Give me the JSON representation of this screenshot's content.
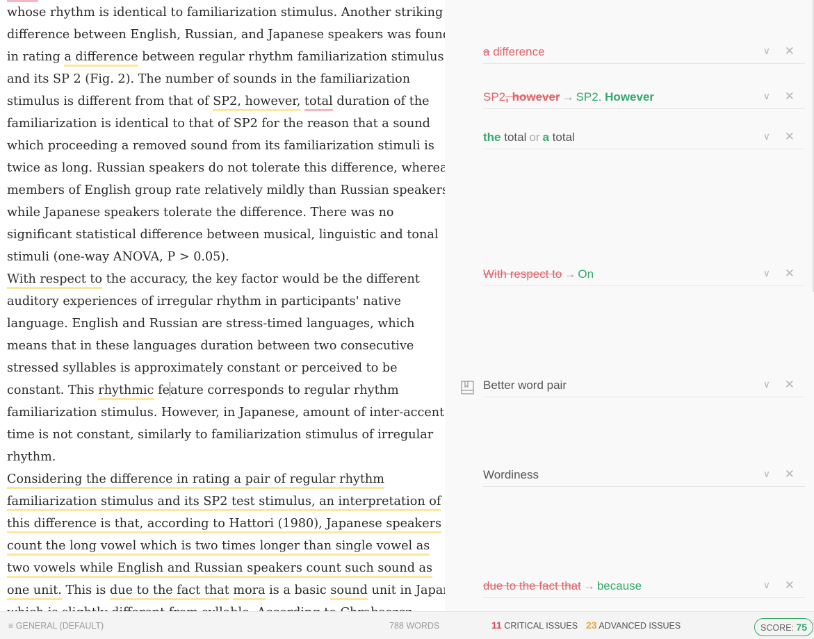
{
  "document": {
    "lines": [
      [
        {
          "t": "whose rhythm is identical to familiarization stimulus. Another striking"
        }
      ],
      [
        {
          "t": "difference between English, Russian, and Japanese speakers was found"
        }
      ],
      [
        {
          "t": "in rating "
        },
        {
          "t": "a difference",
          "u": "y"
        },
        {
          "t": " between regular rhythm familiarization stimulus"
        }
      ],
      [
        {
          "t": "and its SP 2 (Fig. 2). The number of sounds in the familiarization"
        }
      ],
      [
        {
          "t": "stimulus is different from that of "
        },
        {
          "t": "SP2, however,",
          "u": "y"
        },
        {
          "t": " "
        },
        {
          "t": "total",
          "u": "r"
        },
        {
          "t": " duration of the"
        }
      ],
      [
        {
          "t": "familiarization is identical to that of SP2 for the reason that a sound"
        }
      ],
      [
        {
          "t": "which proceeding a removed sound from its familiarization stimuli is"
        }
      ],
      [
        {
          "t": "twice as long. Russian speakers do not tolerate this difference, whereas"
        }
      ],
      [
        {
          "t": "members of English group rate relatively mildly than Russian speakers"
        }
      ],
      [
        {
          "t": "while Japanese speakers tolerate the difference. There was no"
        }
      ],
      [
        {
          "t": "significant statistical difference between musical, linguistic and tonal"
        }
      ],
      [
        {
          "t": "stimuli (one-way ANOVA, P > 0.05)."
        }
      ],
      [
        {
          "t": "With respect to",
          "u": "y"
        },
        {
          "t": " the accuracy, the key factor would be the different"
        }
      ],
      [
        {
          "t": "auditory experiences of irregular rhythm in participants' native"
        }
      ],
      [
        {
          "t": "language. English and Russian are stress-timed languages, which"
        }
      ],
      [
        {
          "t": "means that in these languages duration between two consecutive"
        }
      ],
      [
        {
          "t": "stressed syllables is approximately constant or perceived to be"
        }
      ],
      [
        {
          "t": "constant. This "
        },
        {
          "t": "rhythmic",
          "u": "y"
        },
        {
          "t": " fe"
        },
        {
          "caret": true
        },
        {
          "t": "ature corresponds to regular rhythm"
        }
      ],
      [
        {
          "t": "familiarization stimulus. However, in Japanese, amount of inter-accent"
        }
      ],
      [
        {
          "t": "time is not constant, similarly to familiarization stimulus of irregular"
        }
      ],
      [
        {
          "t": "rhythm."
        }
      ],
      [
        {
          "t": "Considering the difference in rating a pair of regular rhythm ",
          "u": "y"
        }
      ],
      [
        {
          "t": "familiarization stimulus and its SP2 test stimulus, an interpretation of",
          "u": "y"
        }
      ],
      [
        {
          "t": "this difference is that, according to Hattori (1980), Japanese speakers",
          "u": "y"
        }
      ],
      [
        {
          "t": "count the long vowel which is two times longer than single vowel as",
          "u": "y"
        }
      ],
      [
        {
          "t": "two vowels while English and Russian speakers count such sound as",
          "u": "y"
        }
      ],
      [
        {
          "t": "one unit.",
          "u": "y"
        },
        {
          "t": " This is "
        },
        {
          "t": "due to the fact that",
          "u": "y"
        },
        {
          "t": " "
        },
        {
          "t": "mora",
          "u": "y"
        },
        {
          "t": " is a basic "
        },
        {
          "t": "sound",
          "u": "y"
        },
        {
          "t": " unit in Japan"
        }
      ],
      [
        {
          "t": "which is slightly different from syllable. According to Chrabaszcz"
        }
      ]
    ]
  },
  "suggestions": [
    {
      "segs": [
        {
          "t": "a",
          "c": "del"
        },
        {
          "t": " difference",
          "c": "red"
        }
      ]
    },
    {
      "segs": [
        {
          "t": "SP2",
          "c": "red"
        },
        {
          "t": ", however",
          "c": "del bold"
        },
        {
          "t": "→",
          "c": "arrow"
        },
        {
          "t": "SP2. ",
          "c": "green"
        },
        {
          "t": "However",
          "c": "green bold"
        }
      ]
    },
    {
      "segs": [
        {
          "t": "the",
          "c": "green bold"
        },
        {
          "t": " total",
          "c": "gray"
        },
        {
          "t": "or",
          "c": "or"
        },
        {
          "t": "a",
          "c": "green bold"
        },
        {
          "t": " total",
          "c": "gray"
        }
      ]
    },
    {
      "segs": [
        {
          "t": "With respect to",
          "c": "del"
        },
        {
          "t": "→",
          "c": "arrow"
        },
        {
          "t": "On",
          "c": "green"
        }
      ]
    },
    {
      "segs": [
        {
          "t": "Better word pair",
          "c": "gray"
        }
      ],
      "icon": "book-icon"
    },
    {
      "segs": [
        {
          "t": "Wordiness",
          "c": "gray"
        }
      ]
    },
    {
      "segs": [
        {
          "t": "due to the fact that",
          "c": "del"
        },
        {
          "t": "→",
          "c": "arrow"
        },
        {
          "t": "because",
          "c": "green"
        }
      ]
    }
  ],
  "icons": {
    "expand": "chevron-down-icon",
    "dismiss": "close-icon",
    "menu": "hamburger-icon"
  },
  "status": {
    "genre_icon": "≡",
    "genre": "GENERAL (DEFAULT)",
    "words": "788 WORDS",
    "critical_count": "11",
    "critical_label": "CRITICAL ISSUES",
    "advanced_count": "23",
    "advanced_label": "ADVANCED ISSUES",
    "score_label": "SCORE:",
    "score_value": "75"
  },
  "colors": {
    "critical": "#e0454f",
    "advanced": "#f0a52e",
    "score": "#35a86b",
    "underline_yellow": "#fbe89a",
    "underline_red": "#f3b6c2"
  }
}
